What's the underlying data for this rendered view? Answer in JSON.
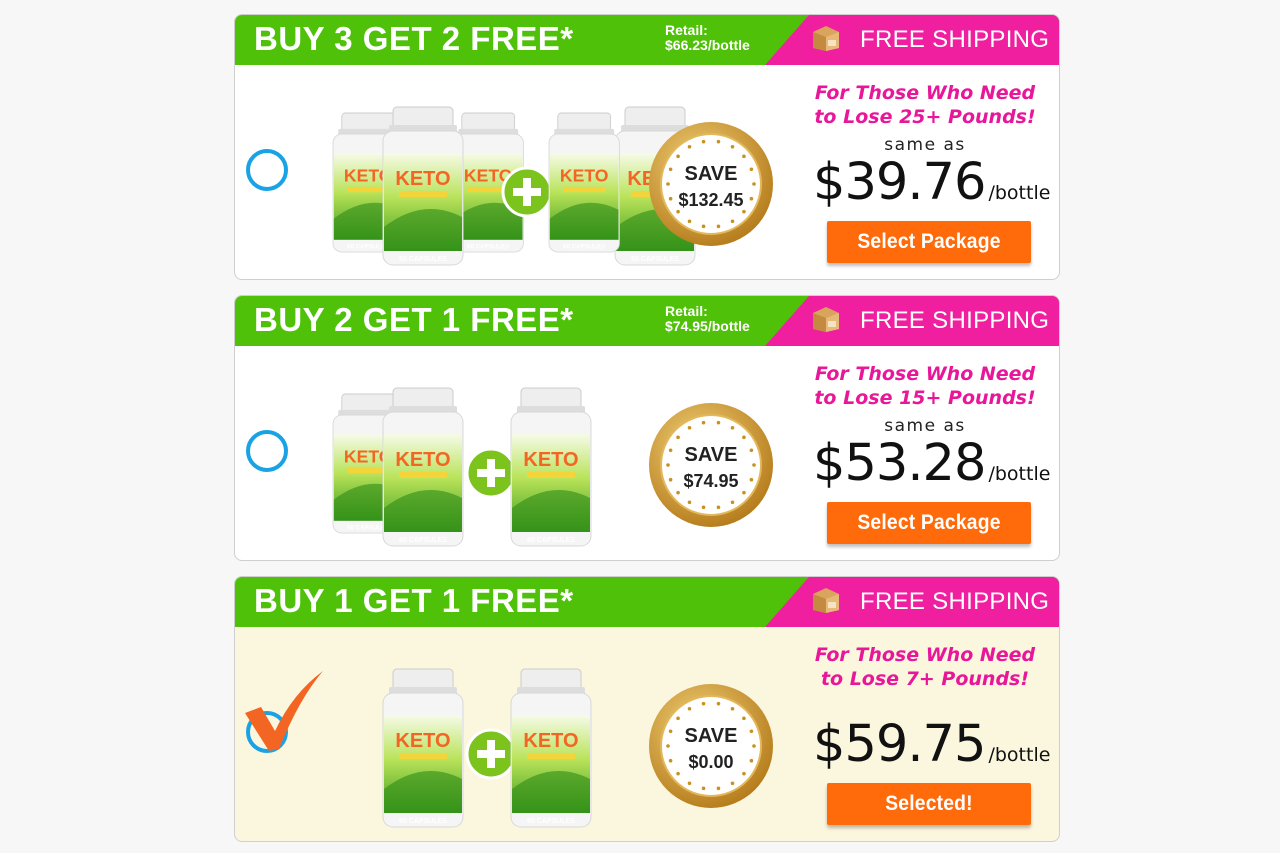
{
  "colors": {
    "header_green": "#4fc108",
    "shipping_pink": "#f01fa0",
    "pitch_pink": "#e8179a",
    "button_orange": "#ff6b0b",
    "radio_blue": "#1aa3e4",
    "check_orange": "#f26522",
    "selected_bg": "#fbf6de",
    "save_badge_gold": "#c9921e"
  },
  "icons": {
    "shipping": "shipping-box-icon",
    "radio": "radio-circle-icon",
    "check": "checkmark-icon",
    "plus": "plus-icon"
  },
  "packages": [
    {
      "title": "BUY 3 GET 2 FREE*",
      "retail_label": "Retail:",
      "retail_value": "$66.23/bottle",
      "shipping": "FREE SHIPPING",
      "pitch_line1": "For Those Who Need",
      "pitch_line2": "to Lose 25+ Pounds!",
      "same_as": "same as",
      "price": "$39.76",
      "per": "/bottle",
      "save_label": "SAVE",
      "save_amount": "$132.45",
      "button": "Select Package",
      "selected": false,
      "product_label": "KETO",
      "capsules": "60 CAPSULES"
    },
    {
      "title": "BUY 2 GET 1 FREE*",
      "retail_label": "Retail:",
      "retail_value": "$74.95/bottle",
      "shipping": "FREE SHIPPING",
      "pitch_line1": "For Those Who Need",
      "pitch_line2": "to Lose 15+ Pounds!",
      "same_as": "same as",
      "price": "$53.28",
      "per": "/bottle",
      "save_label": "SAVE",
      "save_amount": "$74.95",
      "button": "Select Package",
      "selected": false,
      "product_label": "KETO",
      "capsules": "60 CAPSULES"
    },
    {
      "title": "BUY 1 GET 1 FREE*",
      "shipping": "FREE SHIPPING",
      "pitch_line1": "For Those Who Need",
      "pitch_line2": "to Lose 7+ Pounds!",
      "price": "$59.75",
      "per": "/bottle",
      "save_label": "SAVE",
      "save_amount": "$0.00",
      "button": "Selected!",
      "selected": true,
      "product_label": "KETO",
      "capsules": "60 CAPSULES"
    }
  ]
}
